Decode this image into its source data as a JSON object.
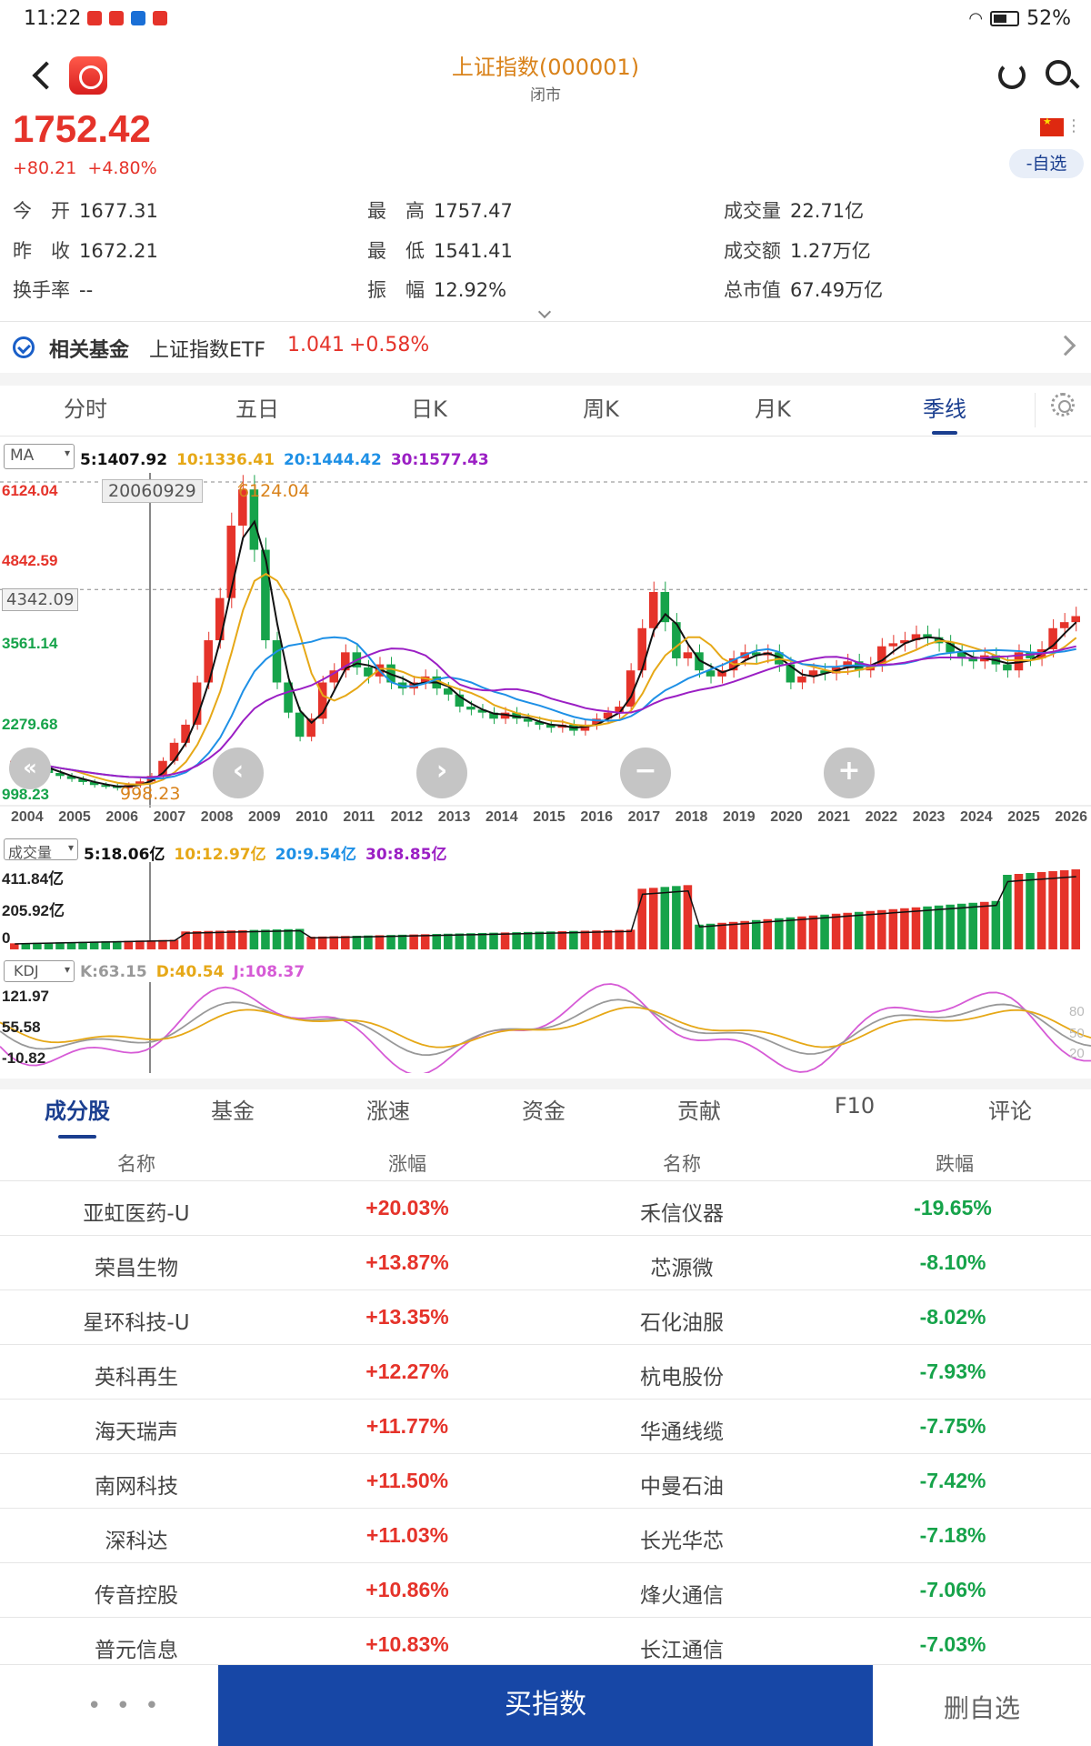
{
  "status_bar": {
    "time": "11:22",
    "battery": "52%"
  },
  "header": {
    "title": "上证指数(000001)",
    "subtitle": "闭市"
  },
  "quote": {
    "price": "1752.42",
    "change": "+80.21",
    "change_pct": "+4.80%",
    "watch_label": "-自选"
  },
  "stats": [
    {
      "label": "今　开",
      "value": "1677.31"
    },
    {
      "label": "最　高",
      "value": "1757.47"
    },
    {
      "label": "成交量",
      "value": "22.71亿"
    },
    {
      "label": "昨　收",
      "value": "1672.21"
    },
    {
      "label": "最　低",
      "value": "1541.41"
    },
    {
      "label": "成交额",
      "value": "1.27万亿"
    },
    {
      "label": "换手率",
      "value": "--"
    },
    {
      "label": "振　幅",
      "value": "12.92%"
    },
    {
      "label": "总市值",
      "value": "67.49万亿"
    }
  ],
  "related_fund": {
    "label": "相关基金",
    "name": "上证指数ETF",
    "price": "1.041",
    "change": "+0.58%"
  },
  "kline_tabs": [
    "分时",
    "五日",
    "日K",
    "周K",
    "月K",
    "季线"
  ],
  "kline_active": 5,
  "chart": {
    "indicator": "MA",
    "legend": [
      {
        "text": "5:1407.92",
        "color": "#111111"
      },
      {
        "text": "10:1336.41",
        "color": "#e6a817"
      },
      {
        "text": "20:1444.42",
        "color": "#1e90e6"
      },
      {
        "text": "30:1577.43",
        "color": "#9b1fc4"
      }
    ],
    "y_labels": [
      {
        "text": "6124.04",
        "color": "#e5332a"
      },
      {
        "text": "4842.59",
        "color": "#e5332a"
      },
      {
        "text": "3561.14",
        "color": "#16a34a"
      },
      {
        "text": "2279.68",
        "color": "#16a34a"
      },
      {
        "text": "998.23",
        "color": "#16a34a"
      }
    ],
    "cursor_date": "20060929",
    "cursor_price": "4342.09",
    "high_annotation": "6124.04",
    "low_annotation": "998.23",
    "x_ticks": [
      "2004",
      "2005",
      "2006",
      "2007",
      "2008",
      "2009",
      "2010",
      "2011",
      "2012",
      "2013",
      "2014",
      "2015",
      "2016",
      "2017",
      "2018",
      "2019",
      "2020",
      "2021",
      "2022",
      "2023",
      "2024",
      "2025",
      "2026"
    ]
  },
  "volume": {
    "indicator": "成交量",
    "legend": [
      {
        "text": "5:18.06亿",
        "color": "#111111"
      },
      {
        "text": "10:12.97亿",
        "color": "#e6a817"
      },
      {
        "text": "20:9.54亿",
        "color": "#1e90e6"
      },
      {
        "text": "30:8.85亿",
        "color": "#9b1fc4"
      }
    ],
    "y_labels": [
      "411.84亿",
      "205.92亿",
      "0"
    ]
  },
  "kdj": {
    "indicator": "KDJ",
    "legend": [
      {
        "text": "K:63.15",
        "color": "#999999"
      },
      {
        "text": "D:40.54",
        "color": "#e6a817"
      },
      {
        "text": "J:108.37",
        "color": "#d65bd6"
      }
    ],
    "y_labels": [
      "121.97",
      "55.58",
      "-10.82"
    ],
    "right_labels": [
      "80",
      "50",
      "20"
    ]
  },
  "sub_tabs": [
    "成分股",
    "基金",
    "涨速",
    "资金",
    "贡献",
    "F10",
    "评论"
  ],
  "sub_active": 0,
  "table": {
    "headers": [
      "名称",
      "涨幅",
      "名称",
      "跌幅"
    ],
    "rows": [
      [
        "亚虹医药-U",
        "+20.03%",
        "禾信仪器",
        "-19.65%"
      ],
      [
        "荣昌生物",
        "+13.87%",
        "芯源微",
        "-8.10%"
      ],
      [
        "星环科技-U",
        "+13.35%",
        "石化油服",
        "-8.02%"
      ],
      [
        "英科再生",
        "+12.27%",
        "杭电股份",
        "-7.93%"
      ],
      [
        "海天瑞声",
        "+11.77%",
        "华通线缆",
        "-7.75%"
      ],
      [
        "南网科技",
        "+11.50%",
        "中曼石油",
        "-7.42%"
      ],
      [
        "深科达",
        "+11.03%",
        "长光华芯",
        "-7.18%"
      ],
      [
        "传音控股",
        "+10.86%",
        "烽火通信",
        "-7.06%"
      ],
      [
        "普元信息",
        "+10.83%",
        "长江通信",
        "-7.03%"
      ]
    ]
  },
  "actions": {
    "more": "• • •",
    "buy": "买指数",
    "unwatch": "删自选"
  },
  "colors": {
    "up": "#e5332a",
    "down": "#16a34a",
    "brand": "#1747a6",
    "title": "#d9821a"
  }
}
